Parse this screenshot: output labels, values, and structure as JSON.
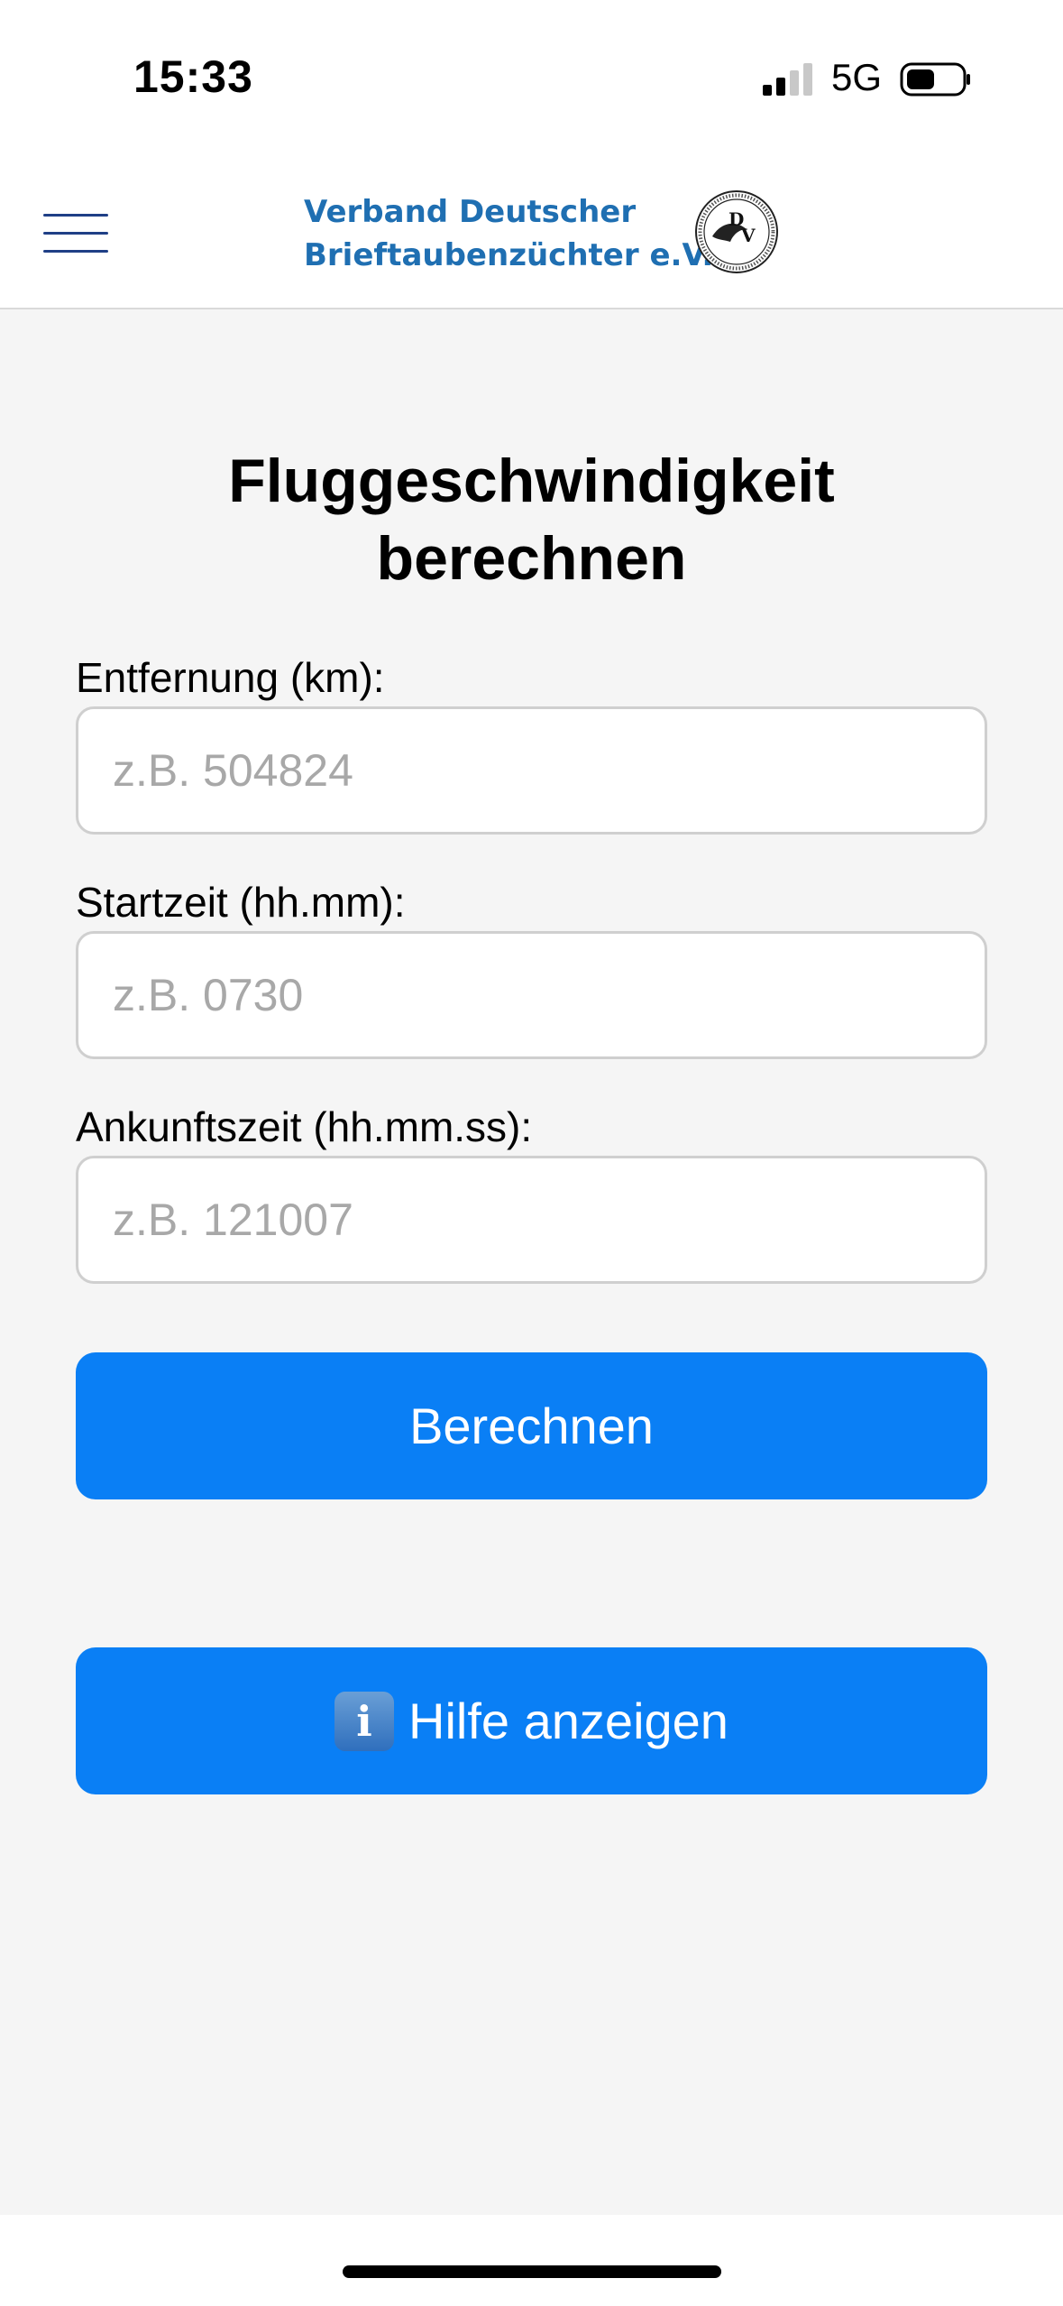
{
  "status_bar": {
    "time": "15:33",
    "network": "5G",
    "icons": [
      "signal-icon",
      "battery-icon"
    ]
  },
  "header": {
    "brand_line1": "Verband Deutscher",
    "brand_line2": "Brieftaubenzüchter e.V.",
    "logo_text": "DV",
    "menu_icon": "hamburger-menu-icon",
    "brand_color": "#1f6fb2"
  },
  "form": {
    "title_line1": "Fluggeschwindigkeit",
    "title_line2": "berechnen",
    "fields": [
      {
        "label": "Entfernung (km):",
        "placeholder": "z.B. 504824",
        "value": ""
      },
      {
        "label": "Startzeit (hh.mm):",
        "placeholder": "z.B. 0730",
        "value": ""
      },
      {
        "label": "Ankunftszeit (hh.mm.ss):",
        "placeholder": "z.B. 121007",
        "value": ""
      }
    ],
    "calculate_label": "Berechnen",
    "help_label": "Hilfe anzeigen",
    "help_icon": "info-icon",
    "button_color": "#0a7ff5"
  }
}
